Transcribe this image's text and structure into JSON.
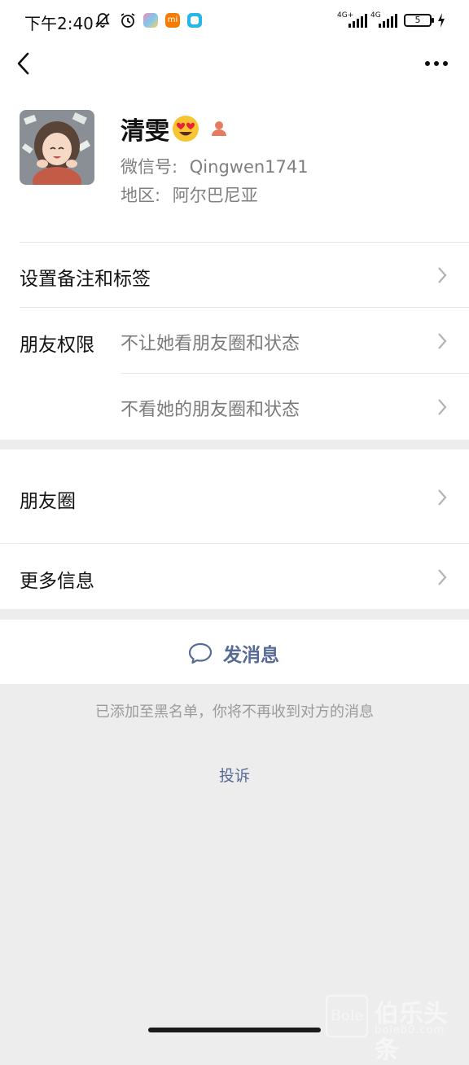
{
  "status_bar": {
    "time": "下午2:40",
    "network_1": "4G+",
    "network_2": "4G",
    "battery": "5"
  },
  "nav": {
    "back_icon": "chevron-left-icon",
    "more_icon": "ellipsis-icon"
  },
  "profile": {
    "name": "清雯",
    "wechat_id_label": "微信号:",
    "wechat_id_value": "Qingwen1741",
    "region_label": "地区:",
    "region_value": "阿尔巴尼亚"
  },
  "cells": {
    "remark_tags": "设置备注和标签",
    "permissions_label": "朋友权限",
    "perm_option_1": "不让她看朋友圈和状态",
    "perm_option_2": "不看她的朋友圈和状态",
    "moments": "朋友圈",
    "more_info": "更多信息"
  },
  "actions": {
    "send_message": "发消息",
    "blacklist_note": "已添加至黑名单，你将不再收到对方的消息",
    "complaint": "投诉"
  },
  "watermark": {
    "logo": "Bole",
    "title": "伯乐头条",
    "subtitle": "bole80.com"
  },
  "colors": {
    "link": "#576b95",
    "background": "#ededed"
  }
}
